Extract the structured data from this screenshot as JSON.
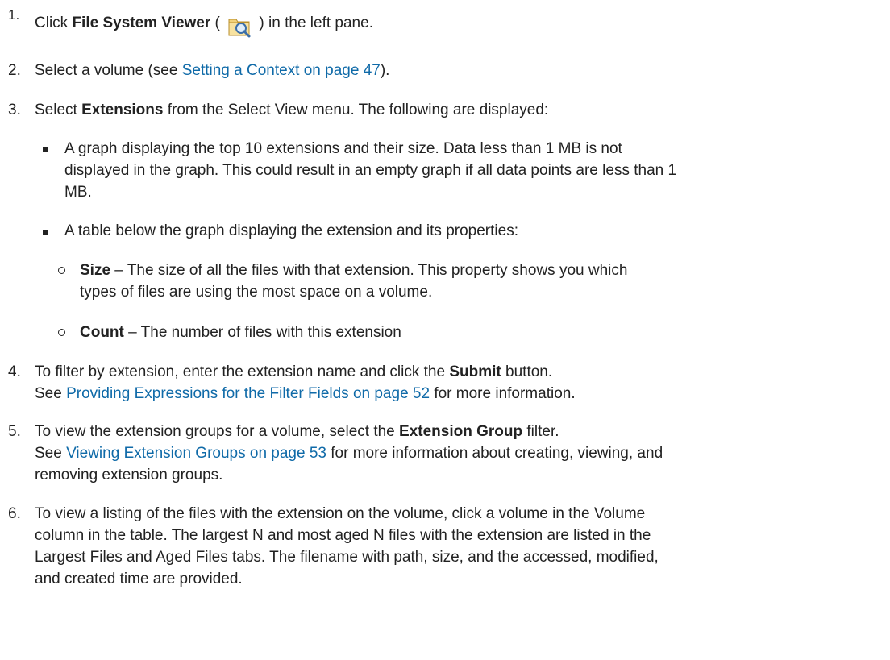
{
  "steps": [
    {
      "num": "1.",
      "a": "Click ",
      "b": "File System Viewer",
      "c": " ( ",
      "d": " ) in the left pane."
    },
    {
      "num": "2.",
      "a": "Select a volume (see ",
      "link": "Setting a Context on page 47",
      "c": ")."
    },
    {
      "num": "3.",
      "a": "Select ",
      "b": "Extensions",
      "c": " from the Select View menu. The following are displayed:"
    },
    {
      "num": "4.",
      "a": "To filter by extension, enter the extension name and click the ",
      "b": "Submit",
      "c": " button.",
      "line2a": "See ",
      "link": "Providing Expressions for the Filter Fields on page 52",
      "line2b": " for more information."
    },
    {
      "num": "5.",
      "a": "To view the extension groups for a volume, select the ",
      "b": "Extension Group",
      "c": " filter.",
      "line2a": "See ",
      "link": "Viewing Extension Groups on page 53",
      "line2b": " for more information about creating, viewing, and",
      "line3": "removing extension groups."
    },
    {
      "num": "6.",
      "l1": "To view a listing of the files with the extension on the volume, click a volume in the Volume",
      "l2": "column in the table. The largest N and most aged N files with the extension are listed in the",
      "l3": "Largest Files and Aged Files tabs. The filename with path, size, and the accessed, modified,",
      "l4": "and created time are provided."
    }
  ],
  "bullets": [
    {
      "l1": "A graph displaying the top 10 extensions and their size. Data less than 1 MB is not",
      "l2": "displayed in the graph. This could result in an empty graph if all data points are less than 1",
      "l3": "MB."
    },
    {
      "l1": "A table below the graph displaying the extension and its properties:"
    }
  ],
  "subbullets": [
    {
      "term": "Size",
      "l1": " – The size of all the files with that extension. This property shows you which",
      "l2": "types of files are using the most space on a volume."
    },
    {
      "term": "Count",
      "l1": " – The number of files with this extension"
    }
  ],
  "icon": "folder-magnifier-icon"
}
